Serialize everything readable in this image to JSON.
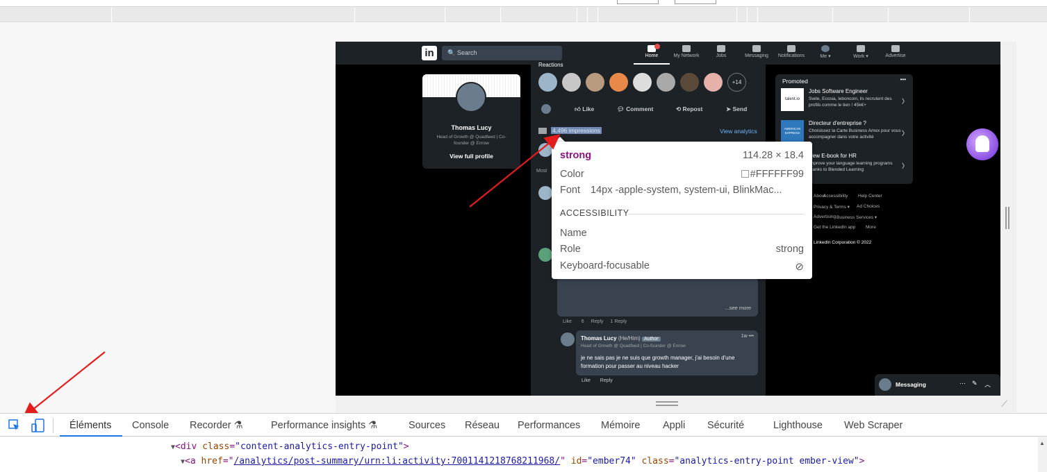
{
  "browser": {
    "viewport_size": ""
  },
  "linkedin": {
    "search_placeholder": "Search",
    "logo": "in",
    "nav": [
      {
        "label": "Home",
        "active": true
      },
      {
        "label": "My Network"
      },
      {
        "label": "Jobs"
      },
      {
        "label": "Messaging"
      },
      {
        "label": "Notifications"
      },
      {
        "label": "Me ▾"
      },
      {
        "label": "Work ▾"
      },
      {
        "label": "Advertise"
      }
    ],
    "profile": {
      "name": "Thomas Lucy",
      "headline": "Head of Growth @ Quadfeed | Co-founder @ Enrow",
      "view_profile": "View full profile"
    },
    "post": {
      "reactions_title": "Reactions",
      "reactions_more": "+14",
      "actions": [
        "Like",
        "Comment",
        "Repost",
        "Send"
      ],
      "impressions": "4,496 impressions",
      "view_analytics": "View analytics",
      "most": "Most",
      "see_more": "...see more",
      "comment_meta": {
        "like": "Like",
        "like_count": "6",
        "reply": "Reply",
        "replies": "1 Reply"
      },
      "reply": {
        "name": "Thomas Lucy",
        "pronoun": "(He/Him)",
        "badge": "Author",
        "headline": "Head of Growth @ Quadfeed | Co-founder @ Enrow",
        "time": "1w •••",
        "text": "je ne sais pas je ne suis que growth manager, j'ai besoin d'une formation pour passer au niveau hacker",
        "like": "Like",
        "reply": "Reply"
      }
    },
    "promoted": {
      "title": "Promoted",
      "more": "•••",
      "items": [
        {
          "logo": "talent.io",
          "title": "Jobs Software Engineer",
          "desc": "Swile, Ecosia, leboncoin, ils recrutent des profils comme le tien ! 45k€+"
        },
        {
          "logo": "AMERICAN EXPRESS",
          "title": "Directeur d'entreprise ?",
          "desc": "Choisissez la Carte Business Amex pour vous accompagner dans votre activité"
        },
        {
          "logo": "",
          "title": "New E-book for HR",
          "desc": "Improve your language learning programs thanks to Blended Learning"
        }
      ]
    },
    "footer": [
      "About",
      "Accessibility",
      "Help Center",
      "Privacy & Terms ▾",
      "Ad Choices",
      "Advertising",
      "Business Services ▾",
      "Get the LinkedIn app",
      "More",
      "LinkedIn Corporation © 2022"
    ],
    "messaging": "Messaging"
  },
  "tooltip": {
    "tag": "strong",
    "dims": "114.28 × 18.4",
    "color_label": "Color",
    "color_value": "#FFFFFF99",
    "font_label": "Font",
    "font_value": "14px -apple-system, system-ui, BlinkMac...",
    "section": "ACCESSIBILITY",
    "name_label": "Name",
    "role_label": "Role",
    "role_value": "strong",
    "focus_label": "Keyboard-focusable"
  },
  "devtools": {
    "tabs": [
      "Éléments",
      "Console",
      "Recorder",
      "Performance insights",
      "Sources",
      "Réseau",
      "Performances",
      "Mémoire",
      "Appli",
      "Sécurité",
      "Lighthouse",
      "Web Scraper"
    ],
    "code_line1": {
      "tag_open": "<div ",
      "attr": "class",
      "eq": "=",
      "val": "\"content-analytics-entry-point\"",
      "close": ">"
    },
    "code_line2": {
      "tag_open": "<a ",
      "href_attr": "href",
      "href_val": "/analytics/post-summary/urn:li:activity:7001141218768211968/",
      "id_attr": "id",
      "id_val": "\"ember74\"",
      "class_attr": "class",
      "class_val": "\"analytics-entry-point ember-view\"",
      "close": ">"
    }
  },
  "colors": {
    "accent": "#1a73e8",
    "tooltip_tag": "#881280",
    "impressions_highlight": "#6f8bb3",
    "annotation_arrow": "#e51c1c"
  }
}
